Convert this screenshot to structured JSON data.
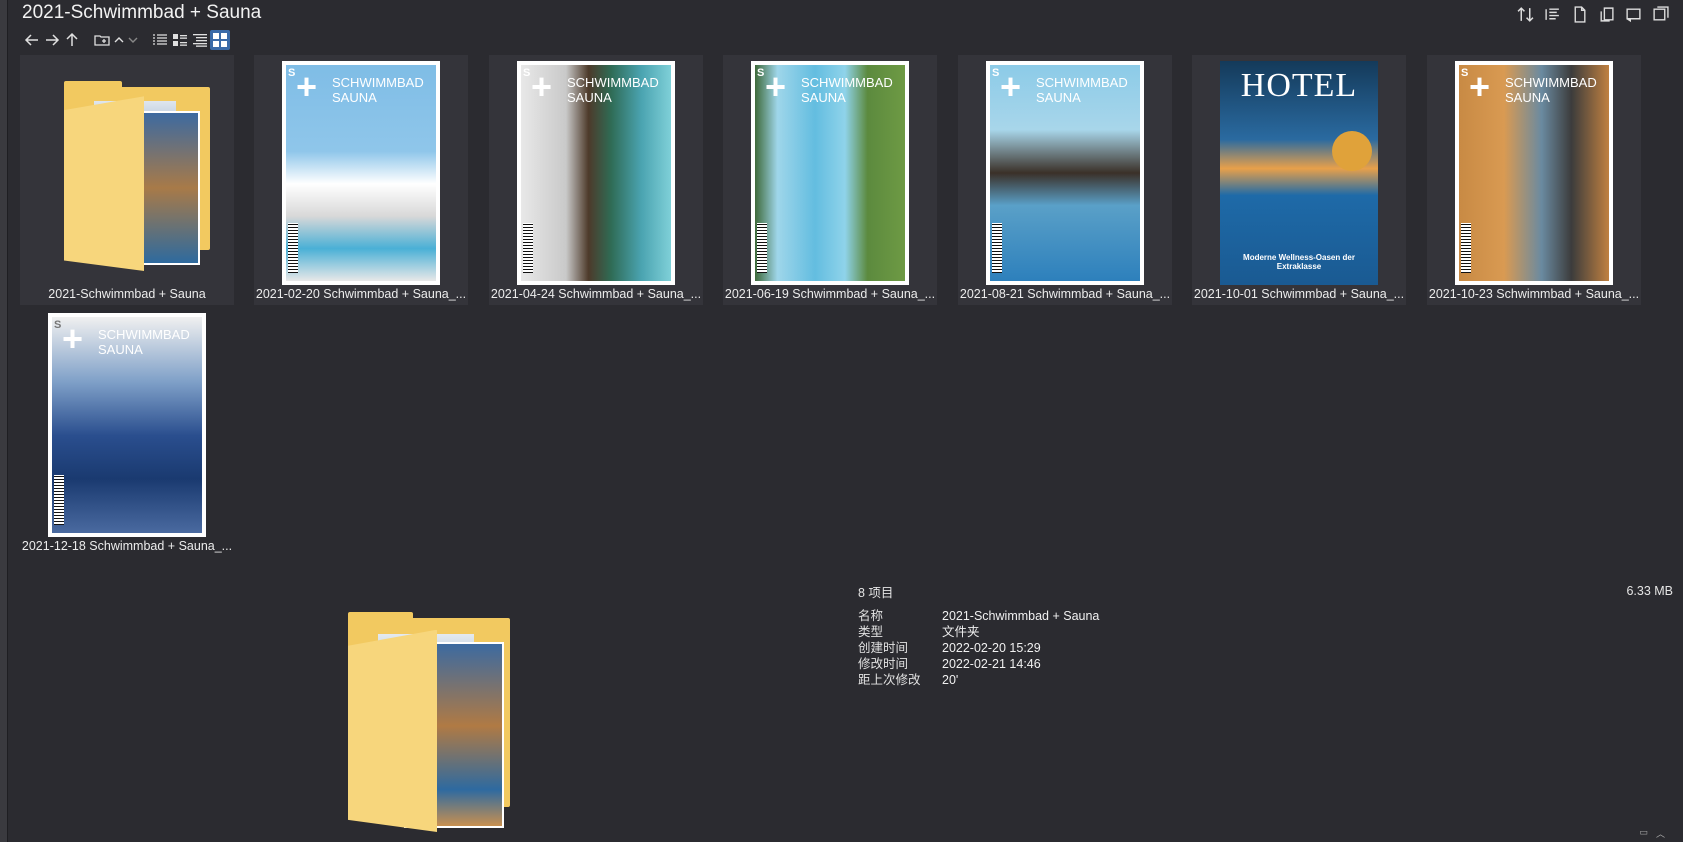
{
  "window": {
    "title": "2021-Schwimmbad + Sauna"
  },
  "toolbar_right": [
    {
      "icon": "sort-icon"
    },
    {
      "icon": "details-pane-icon"
    },
    {
      "icon": "document-icon"
    },
    {
      "icon": "copy-path-icon"
    },
    {
      "icon": "preview-pane-icon"
    },
    {
      "icon": "window-icon"
    }
  ],
  "nav": [
    {
      "icon": "back-arrow-icon"
    },
    {
      "icon": "forward-arrow-icon"
    },
    {
      "icon": "up-arrow-icon"
    },
    {
      "icon": "new-folder-icon"
    },
    {
      "icon": "chevron-up-icon"
    },
    {
      "icon": "chevron-down-icon"
    },
    {
      "icon": "list-view-icon"
    },
    {
      "icon": "details-view-icon"
    },
    {
      "icon": "tiles-view-icon"
    },
    {
      "icon": "thumbnail-view-icon",
      "active": true
    }
  ],
  "items": [
    {
      "label": "2021-Schwimmbad + Sauna",
      "kind": "folder"
    },
    {
      "label": "2021-02-20 Schwimmbad + Sauna_...",
      "kind": "magazine",
      "color": "#6fb0de"
    },
    {
      "label": "2021-04-24 Schwimmbad + Sauna_...",
      "kind": "magazine",
      "color": "#3a8a92"
    },
    {
      "label": "2021-06-19 Schwimmbad + Sauna_...",
      "kind": "magazine",
      "color": "#5cb6d9"
    },
    {
      "label": "2021-08-21 Schwimmbad + Sauna_...",
      "kind": "magazine",
      "color": "#3487c4"
    },
    {
      "label": "2021-10-01 Schwimmbad + Sauna_...",
      "kind": "hotel",
      "color": "#1e6aa8",
      "cover_title": "HOTEL",
      "cover_tagline": "Moderne Wellness-Oasen der Extraklasse"
    },
    {
      "label": "2021-10-23 Schwimmbad + Sauna_...",
      "kind": "magazine",
      "color": "#b97a3c"
    },
    {
      "label": "2021-12-18 Schwimmbad + Sauna_...",
      "kind": "magazine",
      "color": "#2a4e8e"
    }
  ],
  "magazine_name": "SCHWIMMBAD\nSAUNA",
  "status": {
    "count": "8 项目",
    "size": "6.33 MB"
  },
  "properties": [
    {
      "key": "名称",
      "value": "2021-Schwimmbad + Sauna"
    },
    {
      "key": "类型",
      "value": "文件夹"
    },
    {
      "key": "创建时间",
      "value": "2022-02-20  15:29"
    },
    {
      "key": "修改时间",
      "value": "2022-02-21  14:46"
    },
    {
      "key": "距上次修改",
      "value": "20'"
    }
  ],
  "colors": {
    "accent": "#3a6aa8",
    "folder": "#f2c960",
    "background": "#2b2b30"
  }
}
